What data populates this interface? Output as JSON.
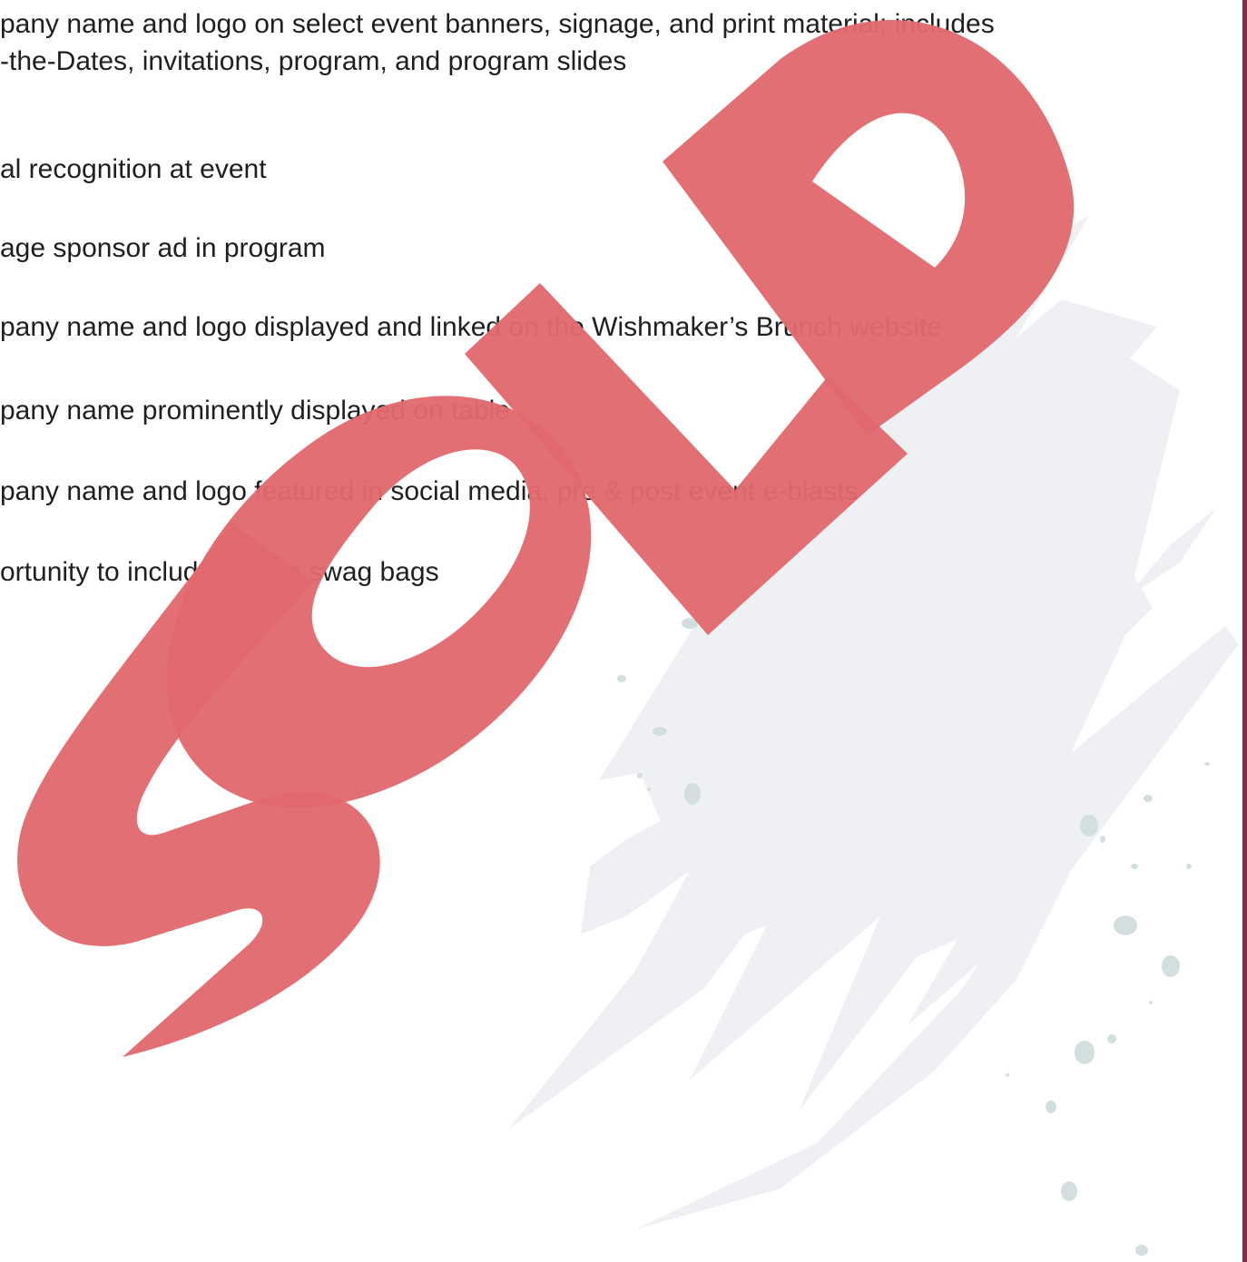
{
  "benefits": [
    "pany name and logo on select event banners, signage, and print material; includes\n-the-Dates, invitations, program, and program slides",
    "al recognition at event",
    "age sponsor ad in program",
    "pany name and logo displayed and linked on the Wishmaker’s Brunch website",
    "pany name prominently displayed on table",
    "pany name and logo featured in social media, pre & post event e-blasts",
    "ortunity to include item in swag bags"
  ],
  "stamp": {
    "text": "SOLD",
    "color": "#e1696d"
  },
  "colors": {
    "border": "#8a2a48",
    "brush": "#eff0f4",
    "splatter": "#d3dfdf",
    "text": "#1f1f23"
  }
}
